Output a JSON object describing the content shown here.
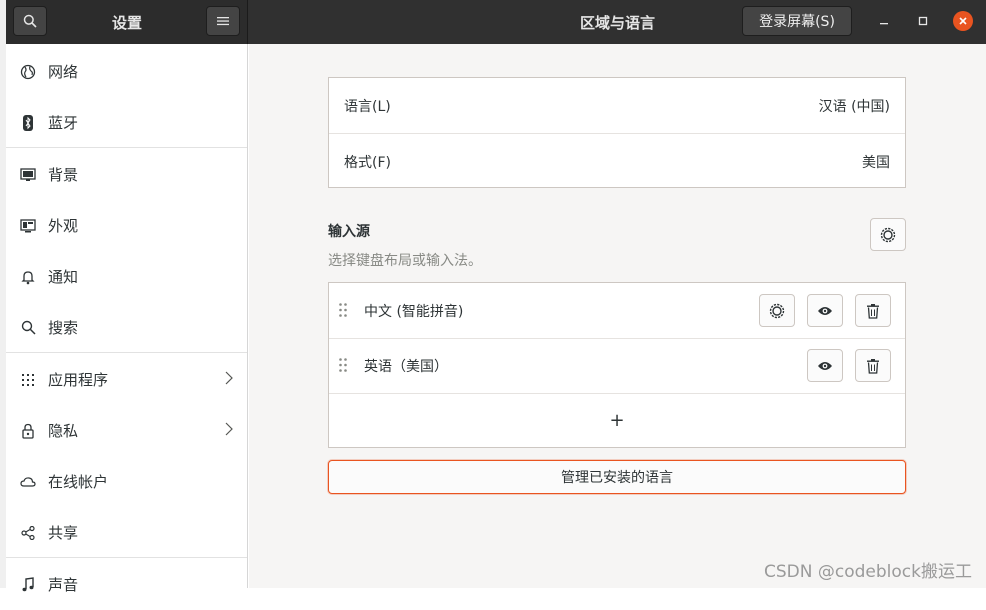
{
  "sidebar_header": {
    "title": "设置"
  },
  "header": {
    "title": "区域与语言",
    "login_button": "登录屏幕(S)"
  },
  "sidebar": {
    "items": [
      {
        "label": "网络",
        "icon": "globe-icon"
      },
      {
        "label": "蓝牙",
        "icon": "bluetooth-icon"
      },
      {
        "label": "背景",
        "icon": "monitor-icon"
      },
      {
        "label": "外观",
        "icon": "appearance-icon"
      },
      {
        "label": "通知",
        "icon": "bell-icon"
      },
      {
        "label": "搜索",
        "icon": "search-icon"
      },
      {
        "label": "应用程序",
        "icon": "grid-icon",
        "has_submenu": true
      },
      {
        "label": "隐私",
        "icon": "lock-icon",
        "has_submenu": true
      },
      {
        "label": "在线帐户",
        "icon": "cloud-icon"
      },
      {
        "label": "共享",
        "icon": "share-icon"
      },
      {
        "label": "声音",
        "icon": "music-icon"
      }
    ]
  },
  "region": {
    "language": {
      "label": "语言(L)",
      "value": "汉语 (中国)"
    },
    "formats": {
      "label": "格式(F)",
      "value": "美国"
    }
  },
  "input_sources": {
    "title": "输入源",
    "subtitle": "选择键盘布局或输入法。",
    "sources": [
      {
        "name": "中文 (智能拼音)",
        "has_settings": true
      },
      {
        "name": "英语（美国）",
        "has_settings": false
      }
    ],
    "add_label": "+"
  },
  "manage_button": "管理已安装的语言",
  "watermark": "CSDN @codeblock搬运工",
  "colors": {
    "accent": "#e95420",
    "header": "#303030",
    "background": "#f6f5f4"
  }
}
